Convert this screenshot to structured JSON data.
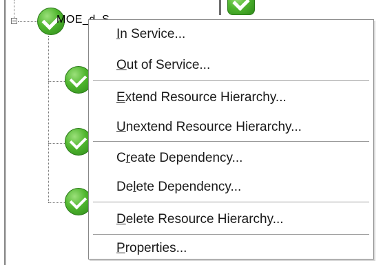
{
  "tree": {
    "node_label": "MOE_d_S"
  },
  "menu": {
    "items": [
      {
        "label": "In Service...",
        "mnemonic_index": 0
      },
      {
        "label": "Out of Service...",
        "mnemonic_index": 0
      },
      {
        "label": "Extend Resource Hierarchy...",
        "mnemonic_index": 0
      },
      {
        "label": "Unextend Resource Hierarchy...",
        "mnemonic_index": 0
      },
      {
        "label": "Create Dependency...",
        "mnemonic_index": 1
      },
      {
        "label": "Delete Dependency...",
        "mnemonic_index": 2
      },
      {
        "label": "Delete Resource Hierarchy...",
        "mnemonic_index": 0
      },
      {
        "label": "Properties...",
        "mnemonic_index": 0
      }
    ]
  },
  "colors": {
    "status_ok": "#4fb52e",
    "menu_bg": "#ffffff",
    "text": "#1a1a1a"
  },
  "icons": {
    "status": "green-check-circle-icon",
    "expander": "collapse-minus-icon"
  }
}
